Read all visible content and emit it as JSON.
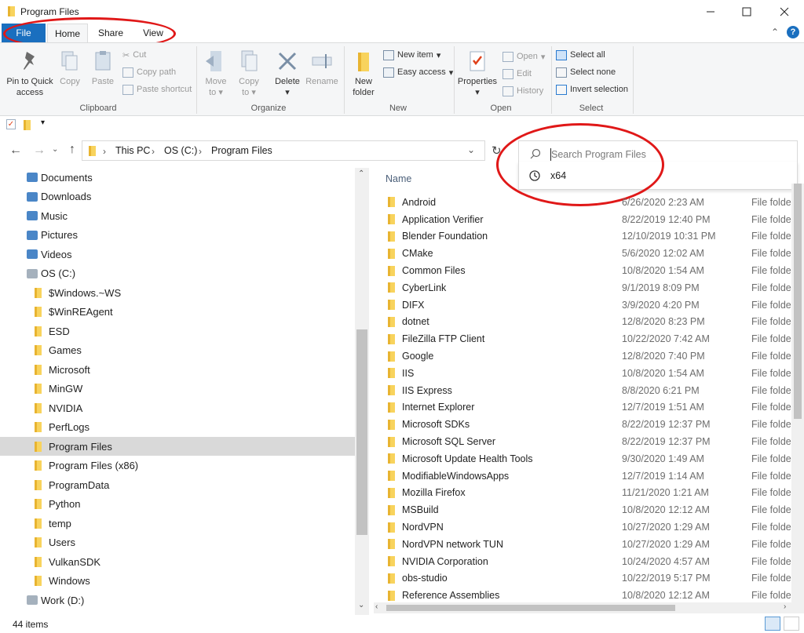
{
  "window": {
    "title": "Program Files",
    "minimize_icon": "minimize-icon",
    "maximize_icon": "maximize-icon",
    "close_icon": "close-icon"
  },
  "ribbon_tabs": [
    "File",
    "Home",
    "Share",
    "View"
  ],
  "ribbon": {
    "clipboard": {
      "pin_label_1": "Pin to Quick",
      "pin_label_2": "access",
      "copy": "Copy",
      "paste": "Paste",
      "cut": "Cut",
      "copy_path": "Copy path",
      "paste_shortcut": "Paste shortcut",
      "group": "Clipboard"
    },
    "organize": {
      "move_1": "Move",
      "move_2": "to",
      "copy_1": "Copy",
      "copy_2": "to",
      "delete": "Delete",
      "rename": "Rename",
      "group": "Organize"
    },
    "new": {
      "folder_1": "New",
      "folder_2": "folder",
      "new_item": "New item",
      "easy_access": "Easy access",
      "group": "New"
    },
    "open": {
      "properties": "Properties",
      "open": "Open",
      "edit": "Edit",
      "history": "History",
      "group": "Open"
    },
    "select": {
      "select_all": "Select all",
      "select_none": "Select none",
      "invert": "Invert selection",
      "group": "Select"
    }
  },
  "address": {
    "path": [
      "This PC",
      "OS (C:)",
      "Program Files"
    ]
  },
  "search": {
    "placeholder": "Search Program Files",
    "suggestion": "x64"
  },
  "nav": {
    "items": [
      {
        "label": "Documents",
        "icon": "documents-icon"
      },
      {
        "label": "Downloads",
        "icon": "downloads-icon"
      },
      {
        "label": "Music",
        "icon": "music-icon"
      },
      {
        "label": "Pictures",
        "icon": "pictures-icon"
      },
      {
        "label": "Videos",
        "icon": "videos-icon"
      },
      {
        "label": "OS (C:)",
        "icon": "drive-icon"
      },
      {
        "label": "$Windows.~WS",
        "icon": "folder-icon"
      },
      {
        "label": "$WinREAgent",
        "icon": "folder-icon"
      },
      {
        "label": "ESD",
        "icon": "folder-icon"
      },
      {
        "label": "Games",
        "icon": "folder-icon"
      },
      {
        "label": "Microsoft",
        "icon": "folder-icon"
      },
      {
        "label": "MinGW",
        "icon": "folder-icon"
      },
      {
        "label": "NVIDIA",
        "icon": "folder-icon"
      },
      {
        "label": "PerfLogs",
        "icon": "folder-icon"
      },
      {
        "label": "Program Files",
        "icon": "folder-icon"
      },
      {
        "label": "Program Files (x86)",
        "icon": "folder-icon"
      },
      {
        "label": "ProgramData",
        "icon": "folder-icon"
      },
      {
        "label": "Python",
        "icon": "folder-icon"
      },
      {
        "label": "temp",
        "icon": "folder-icon"
      },
      {
        "label": "Users",
        "icon": "folder-icon"
      },
      {
        "label": "VulkanSDK",
        "icon": "folder-icon"
      },
      {
        "label": "Windows",
        "icon": "folder-icon"
      },
      {
        "label": "Work (D:)",
        "icon": "drive-icon"
      }
    ]
  },
  "list": {
    "header_name": "Name",
    "rows": [
      {
        "name": "Android",
        "date": "6/26/2020 2:23 AM",
        "type": "File folde"
      },
      {
        "name": "Application Verifier",
        "date": "8/22/2019 12:40 PM",
        "type": "File folde"
      },
      {
        "name": "Blender Foundation",
        "date": "12/10/2019 10:31 PM",
        "type": "File folde"
      },
      {
        "name": "CMake",
        "date": "5/6/2020 12:02 AM",
        "type": "File folde"
      },
      {
        "name": "Common Files",
        "date": "10/8/2020 1:54 AM",
        "type": "File folde"
      },
      {
        "name": "CyberLink",
        "date": "9/1/2019 8:09 PM",
        "type": "File folde"
      },
      {
        "name": "DIFX",
        "date": "3/9/2020 4:20 PM",
        "type": "File folde"
      },
      {
        "name": "dotnet",
        "date": "12/8/2020 8:23 PM",
        "type": "File folde"
      },
      {
        "name": "FileZilla FTP Client",
        "date": "10/22/2020 7:42 AM",
        "type": "File folde"
      },
      {
        "name": "Google",
        "date": "12/8/2020 7:40 PM",
        "type": "File folde"
      },
      {
        "name": "IIS",
        "date": "10/8/2020 1:54 AM",
        "type": "File folde"
      },
      {
        "name": "IIS Express",
        "date": "8/8/2020 6:21 PM",
        "type": "File folde"
      },
      {
        "name": "Internet Explorer",
        "date": "12/7/2019 1:51 AM",
        "type": "File folde"
      },
      {
        "name": "Microsoft SDKs",
        "date": "8/22/2019 12:37 PM",
        "type": "File folde"
      },
      {
        "name": "Microsoft SQL Server",
        "date": "8/22/2019 12:37 PM",
        "type": "File folde"
      },
      {
        "name": "Microsoft Update Health Tools",
        "date": "9/30/2020 1:49 AM",
        "type": "File folde"
      },
      {
        "name": "ModifiableWindowsApps",
        "date": "12/7/2019 1:14 AM",
        "type": "File folde"
      },
      {
        "name": "Mozilla Firefox",
        "date": "11/21/2020 1:21 AM",
        "type": "File folde"
      },
      {
        "name": "MSBuild",
        "date": "10/8/2020 12:12 AM",
        "type": "File folde"
      },
      {
        "name": "NordVPN",
        "date": "10/27/2020 1:29 AM",
        "type": "File folde"
      },
      {
        "name": "NordVPN network TUN",
        "date": "10/27/2020 1:29 AM",
        "type": "File folde"
      },
      {
        "name": "NVIDIA Corporation",
        "date": "10/24/2020 4:57 AM",
        "type": "File folde"
      },
      {
        "name": "obs-studio",
        "date": "10/22/2019 5:17 PM",
        "type": "File folde"
      },
      {
        "name": "Reference Assemblies",
        "date": "10/8/2020 12:12 AM",
        "type": "File folde"
      }
    ]
  },
  "status": {
    "count": "44 items"
  }
}
